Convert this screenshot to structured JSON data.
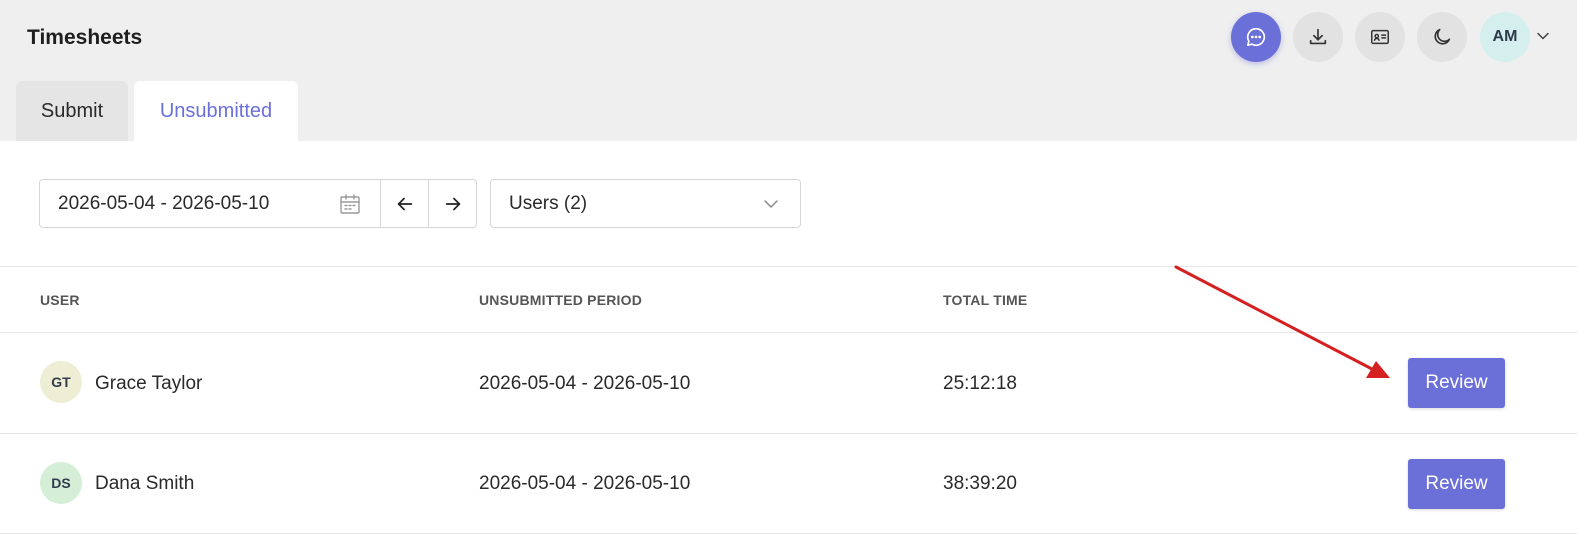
{
  "header": {
    "title": "Timesheets",
    "icons": [
      "chat-icon",
      "download-icon",
      "id-card-icon",
      "moon-icon"
    ],
    "user_initials": "AM",
    "accent": "#6b6fd8"
  },
  "tabs": [
    {
      "label": "Submit",
      "active": false
    },
    {
      "label": "Unsubmitted",
      "active": true
    }
  ],
  "filters": {
    "date_range": "2026-05-04 - 2026-05-10",
    "users_select": "Users (2)"
  },
  "table": {
    "columns": [
      "USER",
      "UNSUBMITTED PERIOD",
      "TOTAL TIME"
    ],
    "rows": [
      {
        "initials": "GT",
        "name": "Grace Taylor",
        "period": "2026-05-04 - 2026-05-10",
        "total": "25:12:18",
        "action": "Review",
        "avatar_color": "#eeeed4"
      },
      {
        "initials": "DS",
        "name": "Dana Smith",
        "period": "2026-05-04 - 2026-05-10",
        "total": "38:39:20",
        "action": "Review",
        "avatar_color": "#d4efd6"
      }
    ]
  },
  "annotation_color": "#d42020"
}
